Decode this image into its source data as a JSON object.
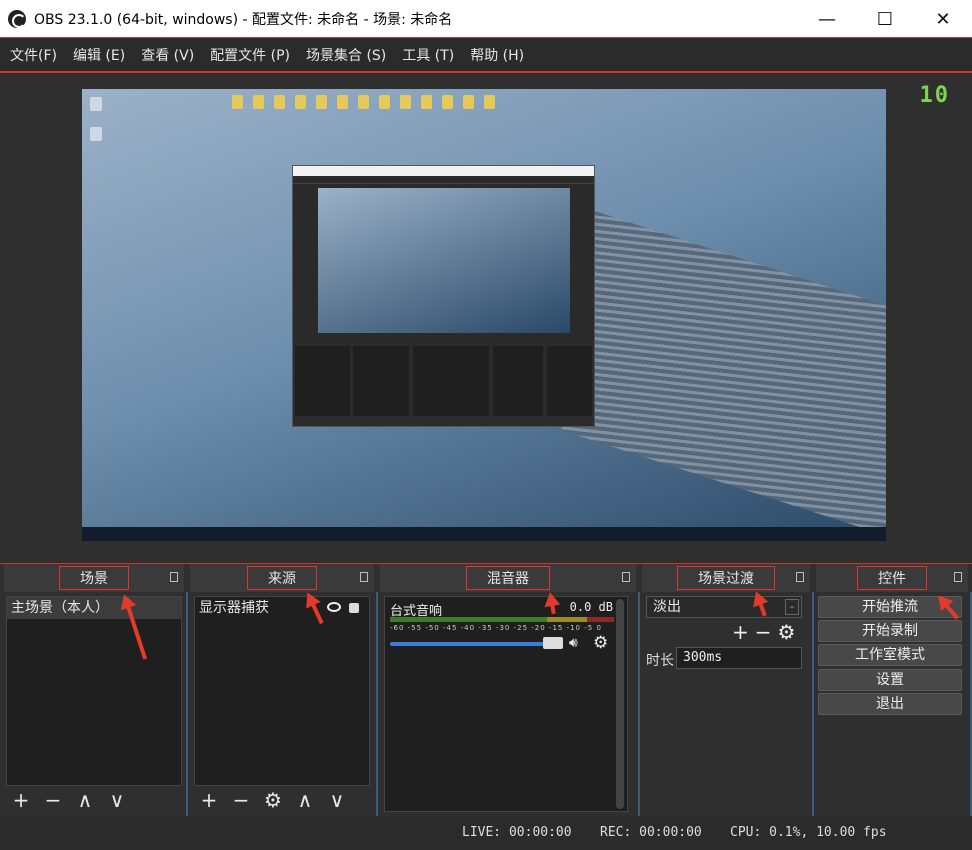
{
  "window": {
    "title": "OBS 23.1.0 (64-bit, windows) - 配置文件: 未命名 - 场景: 未命名",
    "minimize": "—",
    "maximize": "☐",
    "close": "✕"
  },
  "menu": [
    "文件(F)",
    "编辑 (E)",
    "查看 (V)",
    "配置文件 (P)",
    "场景集合 (S)",
    "工具 (T)",
    "帮助 (H)"
  ],
  "docks": {
    "scenes": {
      "title": "场景",
      "items": [
        "主场景（本人）"
      ],
      "toolbar": [
        "+",
        "−",
        "∧",
        "∨"
      ]
    },
    "sources": {
      "title": "来源",
      "items": [
        "显示器捕获"
      ],
      "toolbar": [
        "+",
        "−",
        "⚙",
        "∧",
        "∨"
      ]
    },
    "mixer": {
      "title": "混音器",
      "channel": "台式音响",
      "db": "0.0 dB",
      "scale": "-60 -55 -50 -45 -40 -35 -30 -25 -20 -15 -10 -5 0",
      "volume_percent": 100
    },
    "transitions": {
      "title": "场景过渡",
      "selected": "淡出",
      "duration_label": "时长",
      "duration_value": "300ms"
    },
    "controls": {
      "title": "控件",
      "buttons": [
        "开始推流",
        "开始录制",
        "工作室模式",
        "设置",
        "退出"
      ]
    }
  },
  "status": {
    "live": "LIVE: 00:00:00",
    "rec": "REC: 00:00:00",
    "cpu": "CPU: 0.1%, 10.00 fps"
  },
  "preview_overlay_text": "10",
  "colors": {
    "accent_blue": "#3b7ddb",
    "annotation_red": "#e23b2c",
    "fps_green": "#7fd44b"
  }
}
